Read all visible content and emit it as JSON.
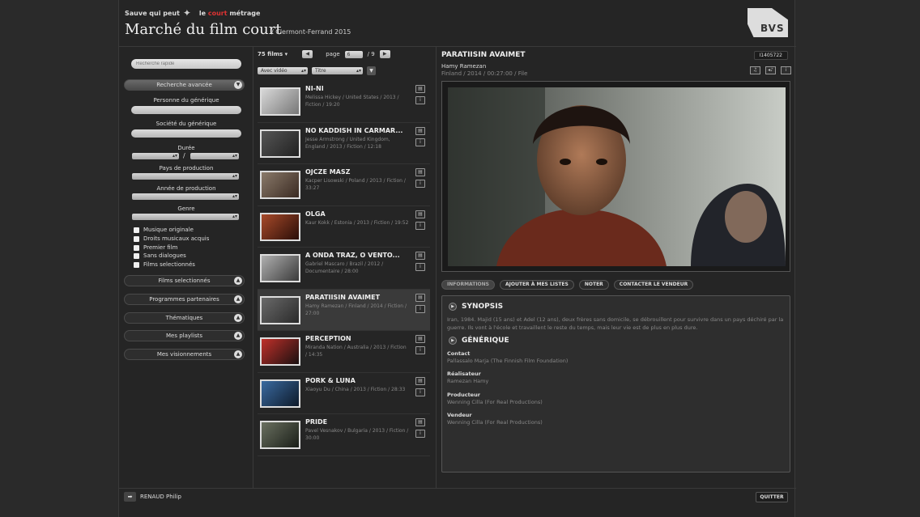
{
  "brand": {
    "left_text": "Sauve qui peut",
    "right_pre": "le ",
    "right_accent": "court",
    "right_post": " métrage"
  },
  "header": {
    "title": "Marché du film court",
    "subtitle": "/ Clermont-Ferrand 2015",
    "logo_text": "BVS"
  },
  "sidebar": {
    "search_placeholder": "Recherche rapide",
    "advanced_label": "Recherche avancée",
    "fields": {
      "person": "Personne du générique",
      "company": "Société du générique",
      "duration": "Durée",
      "duration_sep": "/",
      "country": "Pays de production",
      "year": "Année de production",
      "genre": "Genre"
    },
    "checkboxes": [
      "Musique originale",
      "Droits musicaux acquis",
      "Premier film",
      "Sans dialogues",
      "Films selectionnés"
    ],
    "sections": [
      "Films selectionnés",
      "Programmes partenaires",
      "Thématiques",
      "Mes playlists",
      "Mes visionnements"
    ]
  },
  "list": {
    "count_label": "75 films",
    "count_chevron": "▾",
    "page_label": "page",
    "page_value": "6",
    "page_total": "/ 9",
    "filter_video": "Avec vidéo",
    "filter_sort": "Titre",
    "films": [
      {
        "title": "NI-NI",
        "meta": "Melissa Hickey / United States / 2013 / Fiction / 19:20",
        "thumb": [
          "#d8d8d8",
          "#777"
        ]
      },
      {
        "title": "NO KADDISH IN CARMAR...",
        "meta": "Jesse Armstrong / United Kingdom, England / 2013 / Fiction / 12:18",
        "thumb": [
          "#555",
          "#222"
        ]
      },
      {
        "title": "OJCZE MASZ",
        "meta": "Kacper Lisowski / Poland / 2013 / Fiction / 33:27",
        "thumb": [
          "#8a7a6a",
          "#3a2a22"
        ]
      },
      {
        "title": "OLGA",
        "meta": "Kaur Kokk / Estonia / 2013 / Fiction / 19:52",
        "thumb": [
          "#a84a2a",
          "#2a0e08"
        ]
      },
      {
        "title": "A ONDA TRAZ, O VENTO...",
        "meta": "Gabriel Mascaro / Brazil / 2012 / Documentaire / 28:00",
        "thumb": [
          "#b0b0b0",
          "#3a3a3a"
        ]
      },
      {
        "title": "PARATIISIN AVAIMET",
        "meta": "Hamy Ramezan / Finland / 2014 / Fiction / 27:00",
        "thumb": [
          "#6a6a6a",
          "#2a2a2a"
        ]
      },
      {
        "title": "PERCEPTION",
        "meta": "Miranda Nation / Australia / 2013 / Fiction / 14:35",
        "thumb": [
          "#c0302a",
          "#1a1010"
        ]
      },
      {
        "title": "PORK & LUNA",
        "meta": "Xiaoyu Du / China / 2013 / Fiction / 28:33",
        "thumb": [
          "#3a6aa0",
          "#0e1a2a"
        ]
      },
      {
        "title": "PRIDE",
        "meta": "Pavel Vesnakov / Bulgaria / 2013 / Fiction / 30:00",
        "thumb": [
          "#6a7060",
          "#1a1e18"
        ]
      }
    ]
  },
  "detail": {
    "title": "PARATIISIN AVAIMET",
    "id": "I1405722",
    "director": "Hamy Ramezan",
    "meta": "Finland / 2014 / 00:27:00 / File",
    "tabs": [
      "INFORMATIONS",
      "AJOUTER À MES LISTES",
      "NOTER",
      "CONTACTER LE VENDEUR"
    ],
    "synopsis_head": "SYNOPSIS",
    "synopsis": "Iran, 1984. Majid (15 ans) et Adel (12 ans), deux frères sans domicile, se débrouillent pour survivre dans un pays déchiré par la guerre. Ils vont à l'école et travaillent le reste du temps, mais leur vie est de plus en plus dure.",
    "credits_head": "GÉNÉRIQUE",
    "credits": [
      {
        "role": "Contact",
        "name": "Pallassalo Marja (The Finnish Film Foundation)"
      },
      {
        "role": "Réalisateur",
        "name": "Ramezan Hamy"
      },
      {
        "role": "Producteur",
        "name": "Wenning Cilla (For Real Productions)"
      },
      {
        "role": "Vendeur",
        "name": "Wenning Cilla (For Real Productions)"
      }
    ]
  },
  "footer": {
    "user": "RENAUD Philip",
    "quit": "QUITTER"
  }
}
